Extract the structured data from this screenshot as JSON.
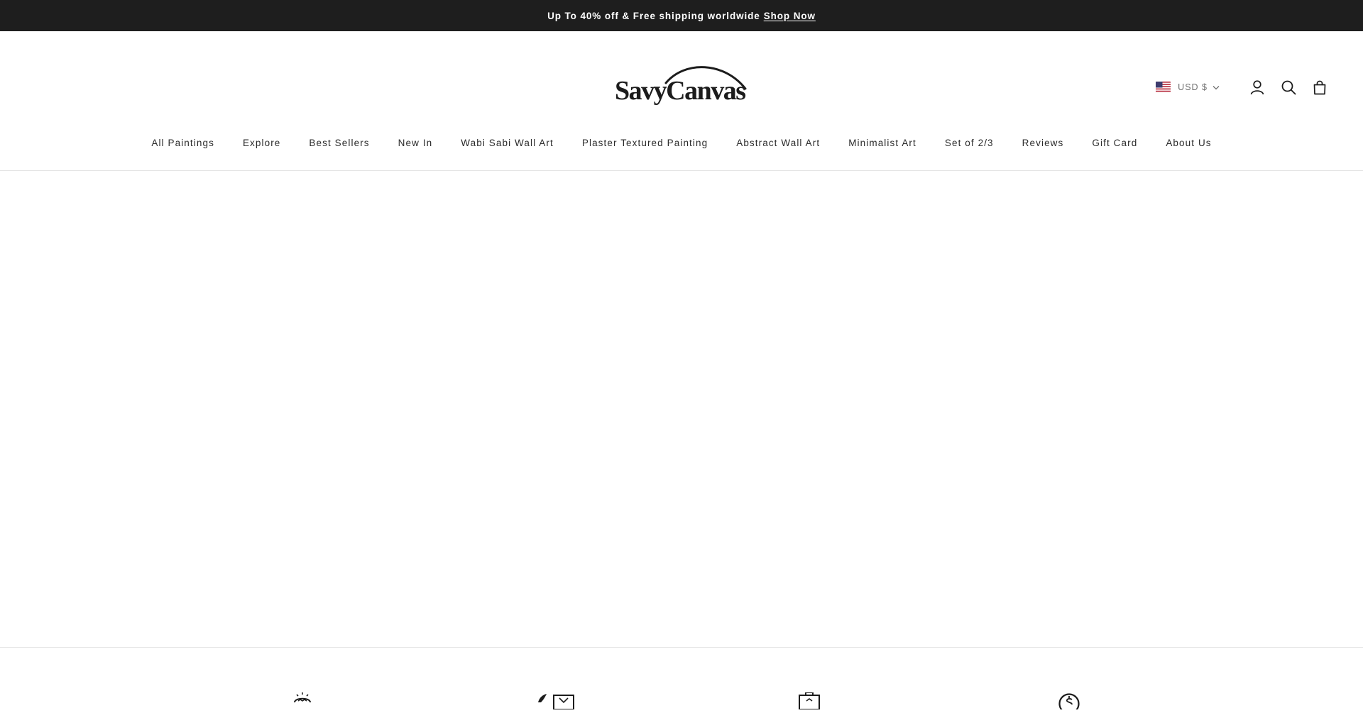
{
  "announcement": {
    "text": "Up To 40% off & Free shipping worldwide",
    "link_label": "Shop Now"
  },
  "brand": {
    "logo_text": "SavyCanvas"
  },
  "header": {
    "currency_label": "USD $",
    "icons": [
      "flag-us-icon",
      "chevron-down-icon",
      "account-icon",
      "search-icon",
      "cart-bag-icon"
    ]
  },
  "nav": {
    "items": [
      "All Paintings",
      "Explore",
      "Best Sellers",
      "New In",
      "Wabi Sabi Wall Art",
      "Plaster Textured Painting",
      "Abstract Wall Art",
      "Minimalist Art",
      "Set of 2/3",
      "Reviews",
      "Gift Card",
      "About Us"
    ]
  },
  "features": {
    "icons": [
      "quality-badge-icon",
      "artist-brush-icon",
      "package-icon",
      "money-back-icon"
    ]
  },
  "colors": {
    "announcement_bg": "#1e1e1e",
    "text": "#1c1c1c",
    "muted": "#707070",
    "border": "#e3e3e3"
  }
}
